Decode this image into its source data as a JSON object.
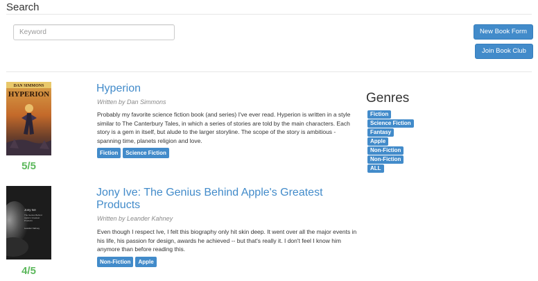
{
  "header": {
    "title": "Search"
  },
  "search": {
    "placeholder": "Keyword",
    "value": ""
  },
  "actions": {
    "new_book": "New Book Form",
    "join_club": "Join Book Club"
  },
  "books": [
    {
      "title": "Hyperion",
      "author_line": "Written by Dan Simmons",
      "description": "Probably my favorite science fiction book (and series) I've ever read. Hyperion is written in a style similar to The Canterbury Tales, in which a series of stories are told by the main characters. Each story is a gem in itself, but alude to the larger storyline. The scope of the story is ambitious - spanning time, planets religion and love.",
      "rating": "5",
      "rating_max": "/5",
      "tags": [
        "Fiction",
        "Science Fiction"
      ],
      "cover": {
        "author": "DAN SIMMONS",
        "title": "HYPERION"
      }
    },
    {
      "title": "Jony Ive: The Genius Behind Apple's Greatest Products",
      "author_line": "Written by Leander Kahney",
      "description": "Even though I respect Ive, I felt this biography only hit skin deep. It went over all the major events in his life, his passion for design, awards he achieved -- but that's really it. I don't feel I know him anymore than before reading this.",
      "rating": "4",
      "rating_max": "/5",
      "tags": [
        "Non-Fiction",
        "Apple"
      ],
      "cover": {
        "title": "Jony Ive",
        "subtitle": "The Genius Behind Apple's Greatest Products",
        "author": "Leander Kahney"
      }
    }
  ],
  "genres": {
    "title": "Genres",
    "items": [
      "Fiction",
      "Science Fiction",
      "Fantasy",
      "Apple",
      "Non-Fiction",
      "Non-Fiction",
      "ALL"
    ]
  },
  "colors": {
    "primary": "#428bca",
    "rating": "#5cb85c"
  }
}
